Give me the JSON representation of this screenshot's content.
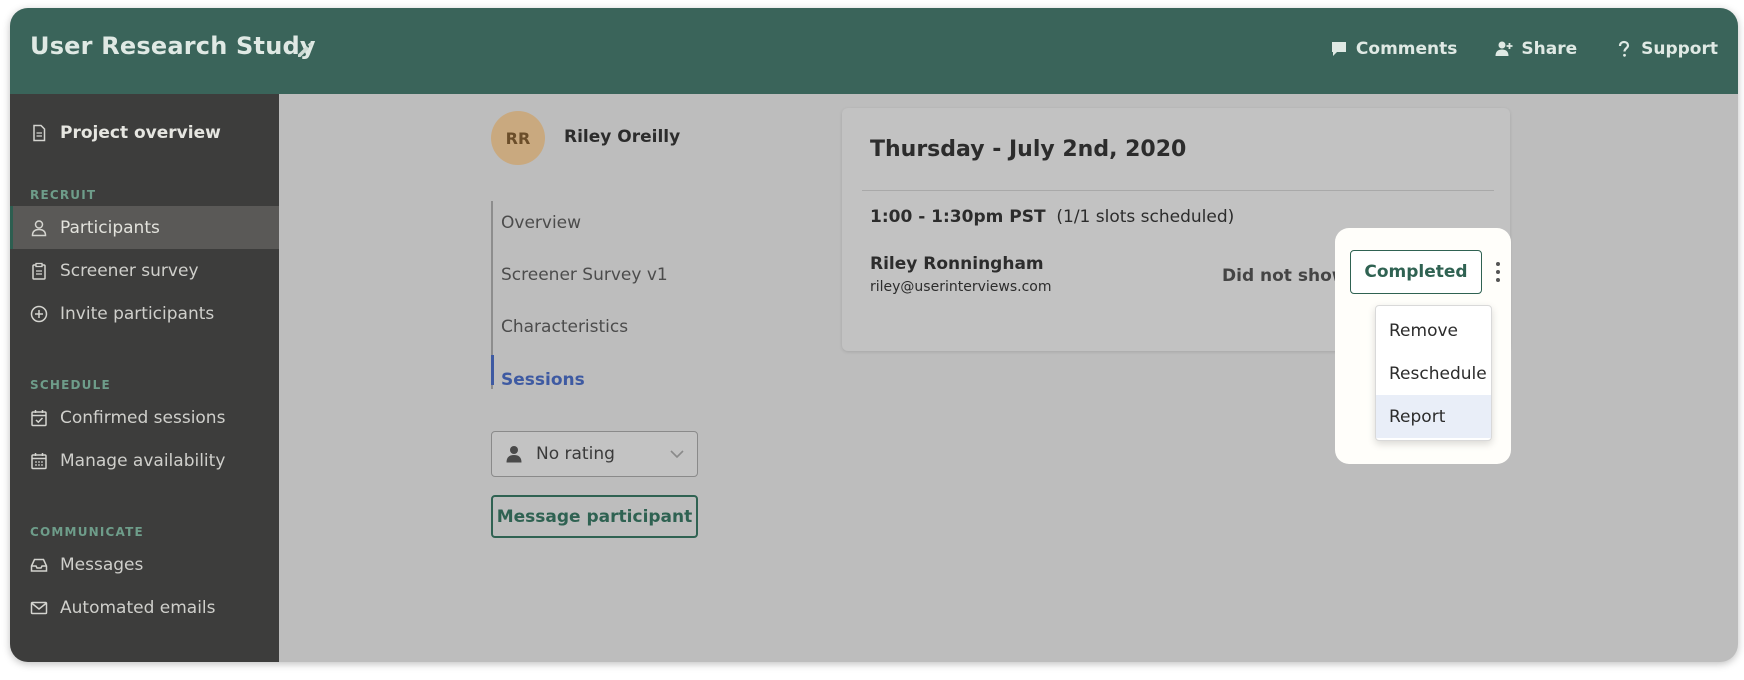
{
  "header": {
    "title": "User Research Study",
    "actions": [
      {
        "label": "Comments",
        "icon": "comment-icon"
      },
      {
        "label": "Share",
        "icon": "add-user-icon"
      },
      {
        "label": "Support",
        "icon": "question-icon"
      }
    ]
  },
  "sidebar": {
    "overview": "Project overview",
    "sections": {
      "recruit": "RECRUIT",
      "schedule": "SCHEDULE",
      "communicate": "COMMUNICATE"
    },
    "items": [
      {
        "label": "Participants",
        "icon": "user-icon",
        "active": true
      },
      {
        "label": "Screener survey",
        "icon": "clipboard-icon"
      },
      {
        "label": "Invite participants",
        "icon": "plus-circle-icon"
      },
      {
        "label": "Confirmed sessions",
        "icon": "calendar-check-icon"
      },
      {
        "label": "Manage availability",
        "icon": "calendar-grid-icon"
      },
      {
        "label": "Messages",
        "icon": "inbox-icon"
      },
      {
        "label": "Automated emails",
        "icon": "mail-icon"
      }
    ]
  },
  "profile": {
    "initials": "RR",
    "name": "Riley Oreilly",
    "nav": [
      "Overview",
      "Screener Survey v1",
      "Characteristics",
      "Sessions"
    ],
    "active_nav": "Sessions",
    "rating": "No rating",
    "message_button": "Message participant"
  },
  "session": {
    "date": "Thursday - July 2nd, 2020",
    "time": "1:00 - 1:30pm PST",
    "slots": "(1/1 slots scheduled)",
    "participant_name": "Riley Ronningham",
    "participant_email": "riley@userinterviews.com",
    "did_not_show": "Did not show",
    "completed": "Completed",
    "menu": [
      "Remove",
      "Reschedule",
      "Report"
    ],
    "menu_hovered": "Report"
  },
  "colors": {
    "header": "#3a645a",
    "sidebar": "#3d3d3c",
    "accent_green": "#2f6252",
    "accent_blue": "#3e5aa2"
  }
}
